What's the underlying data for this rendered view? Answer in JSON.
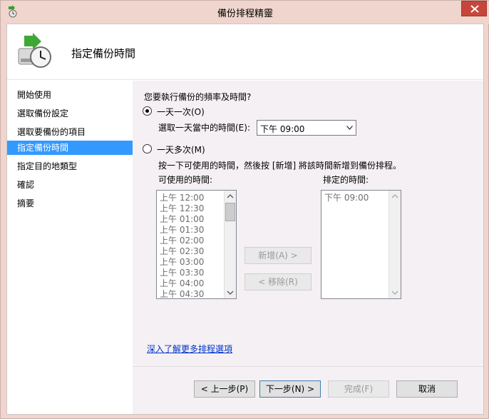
{
  "window": {
    "title": "備份排程精靈",
    "close_icon": "close-icon"
  },
  "header": {
    "title": "指定備份時間",
    "icon": "backup-clock-icon"
  },
  "nav": {
    "items": [
      {
        "label": "開始使用"
      },
      {
        "label": "選取備份設定"
      },
      {
        "label": "選取要備份的項目"
      },
      {
        "label": "指定備份時間",
        "active": true
      },
      {
        "label": "指定目的地類型"
      },
      {
        "label": "確認"
      },
      {
        "label": "摘要"
      }
    ]
  },
  "content": {
    "question": "您要執行備份的頻率及時間?",
    "once_daily_label": "一天一次(O)",
    "select_time_label": "選取一天當中的時間(E):",
    "select_time_value": "下午 09:00",
    "multiple_label": "一天多次(M)",
    "multiple_hint": "按一下可使用的時間，然後按 [新增] 將該時間新增到備份排程。",
    "available_label": "可使用的時間:",
    "scheduled_label": "排定的時間:",
    "available_times": [
      "上午 12:00",
      "上午 12:30",
      "上午 01:00",
      "上午 01:30",
      "上午 02:00",
      "上午 02:30",
      "上午 03:00",
      "上午 03:30",
      "上午 04:00",
      "上午 04:30"
    ],
    "scheduled_times": [
      "下午 09:00"
    ],
    "add_button": "新增(A) >",
    "remove_button": "< 移除(R)",
    "learn_more_link": "深入了解更多排程選項"
  },
  "footer": {
    "back_button": "< 上一步(P)",
    "next_button": "下一步(N) >",
    "finish_button": "完成(F)",
    "cancel_button": "取消"
  }
}
